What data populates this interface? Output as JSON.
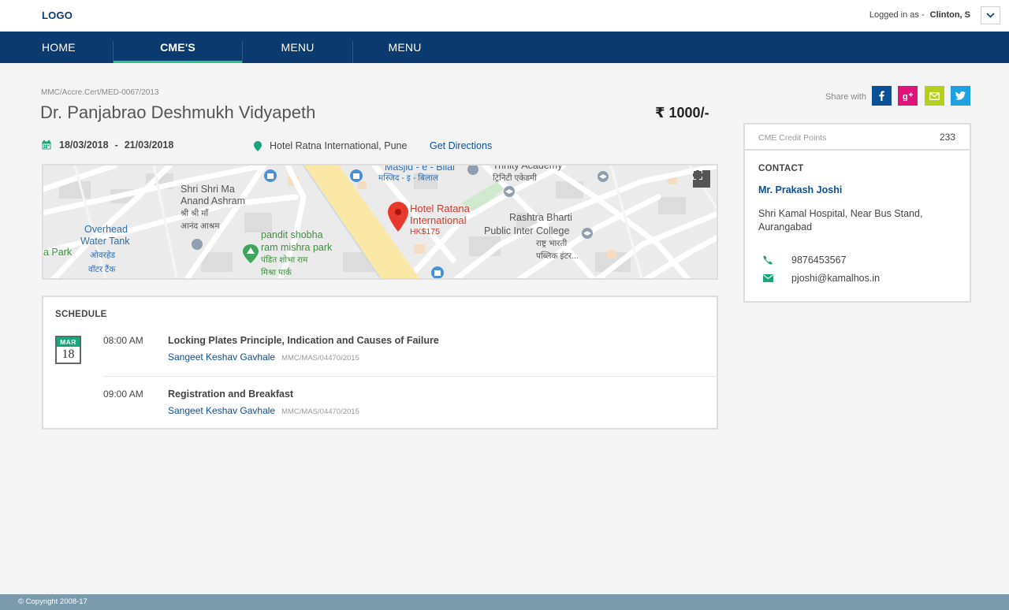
{
  "header": {
    "logo": "LOGO",
    "logged_in_label": "Logged in as  -",
    "user_name": "Clinton, S"
  },
  "nav": {
    "items": [
      {
        "label": "HOME"
      },
      {
        "label": "CME'S"
      },
      {
        "label": "MENU"
      },
      {
        "label": "MENU"
      }
    ]
  },
  "event": {
    "reference": "MMC/Accre.Cert/MED-0067/2013",
    "title": "Dr. Panjabrao Deshmukh Vidyapeth",
    "price": "₹ 1000/-",
    "start_date": "18/03/2018",
    "date_separator": "-",
    "end_date": "21/03/2018",
    "venue": "Hotel Ratna International, Pune",
    "directions_label": "Get Directions"
  },
  "map": {
    "labels": {
      "masjid": "Masjid - e - Bilal",
      "masjid_hi": "मस्जिद - इ - बिलाल",
      "trinity": "Trinity Academy",
      "trinity_hi": "ट्रिनिटी एकेडमी",
      "ashram": "Shri Shri Ma",
      "ashram2": "Anand Ashram",
      "ashram_hi": "श्री श्री माँ",
      "ashram_hi2": "आनंद आश्रम",
      "hotel": "Hotel Ratana",
      "hotel2": "International",
      "hotel_price": "HK$175",
      "college": "Rashtra Bharti",
      "college2": "Public Inter College",
      "college_hi": "राष्ट्र भारती",
      "college_hi2": "पब्लिक इंटर...",
      "tank": "Overhead",
      "tank2": "Water Tank",
      "tank_hi": "ओवरहेड",
      "tank_hi2": "वॉटर टैंक",
      "park": "pandit shobha",
      "park2": "ram mishra park",
      "park_hi": "पंडित शोभा राम",
      "park_hi2": "मिश्रा पार्क",
      "apark": "a Park"
    }
  },
  "schedule": {
    "title": "SCHEDULE",
    "month": "MAR",
    "day": "18",
    "items": [
      {
        "time": "08:00 AM",
        "name": "Locking Plates Principle, Indication and Causes of Failure",
        "speaker": "Sangeet Keshav Gavhale",
        "reg": "MMC/MAS/04470/2015"
      },
      {
        "time": "09:00 AM",
        "name": "Registration and Breakfast",
        "speaker": "Sangeet Keshav Gavhale",
        "reg": "MMC/MAS/04470/2015"
      }
    ]
  },
  "share": {
    "label": "Share with"
  },
  "credits": {
    "label": "CME Credit Points",
    "value": "233"
  },
  "contact": {
    "header": "CONTACT",
    "person": "Mr. Prakash Joshi",
    "address": "Shri Kamal Hospital, Near Bus Stand, Aurangabad",
    "phone": "9876453567",
    "email": "pjoshi@kamalhos.in"
  },
  "footer": {
    "copyright": "© Copyright 2008-17"
  },
  "colors": {
    "nav_bg": "#0b3a6e",
    "accent_green": "#19a67c",
    "link_blue": "#0b4f94",
    "facebook": "#0b4f94",
    "google_plus": "#e0157a",
    "email": "#b5cf1e",
    "twitter": "#1da1e0",
    "footer_bg": "#7b9aab"
  }
}
